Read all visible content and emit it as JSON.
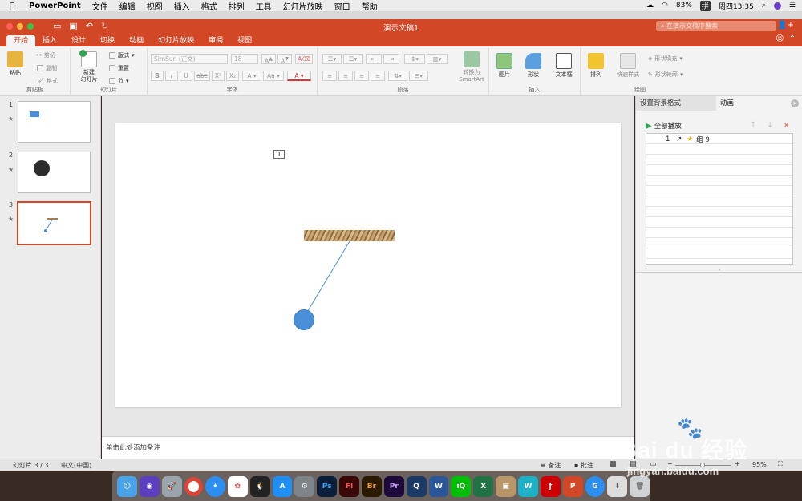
{
  "menubar": {
    "app": "PowerPoint",
    "items": [
      "文件",
      "编辑",
      "视图",
      "插入",
      "格式",
      "排列",
      "工具",
      "幻灯片放映",
      "窗口",
      "帮助"
    ],
    "battery": "83%",
    "ime": "拼",
    "datetime": "周四13:35"
  },
  "window": {
    "title": "演示文稿1",
    "search_placeholder": "在演示文稿中搜索"
  },
  "tabs": [
    "开始",
    "插入",
    "设计",
    "切换",
    "动画",
    "幻灯片放映",
    "审阅",
    "视图"
  ],
  "ribbon": {
    "clipboard": {
      "paste": "粘贴",
      "cut": "剪切",
      "copy": "复制",
      "format": "格式",
      "label": "剪贴板"
    },
    "slides": {
      "new_slide": "新建\n幻灯片",
      "layout": "版式",
      "reset": "重置",
      "section": "节",
      "label": "幻灯片"
    },
    "font": {
      "name": "SimSun (正文)",
      "size": "18",
      "label": "字体"
    },
    "paragraph": {
      "smartart": "转换为\nSmartArt",
      "label": "段落"
    },
    "insert": {
      "picture": "图片",
      "shape": "形状",
      "textbox": "文本框",
      "label": "插入"
    },
    "drawing": {
      "arrange": "排列",
      "quick_styles": "快速样式",
      "fill": "形状填充",
      "outline": "形状轮廓",
      "label": "绘图"
    }
  },
  "slides": [
    {
      "num": "1",
      "star": "★"
    },
    {
      "num": "2",
      "star": "★"
    },
    {
      "num": "3",
      "star": "★"
    }
  ],
  "slide": {
    "anim_tag": "1"
  },
  "notes": "单击此处添加备注",
  "pane": {
    "tab1": "设置背景格式",
    "tab2": "动画",
    "play_all": "全部播放",
    "item_num": "1",
    "item_label": "组 9"
  },
  "status": {
    "slide": "幻灯片 3 / 3",
    "lang": "中文(中国)",
    "notes": "备注",
    "comments": "批注",
    "zoom": "95%"
  },
  "colors": {
    "accent": "#d24726",
    "circle": "#4a90d9"
  }
}
